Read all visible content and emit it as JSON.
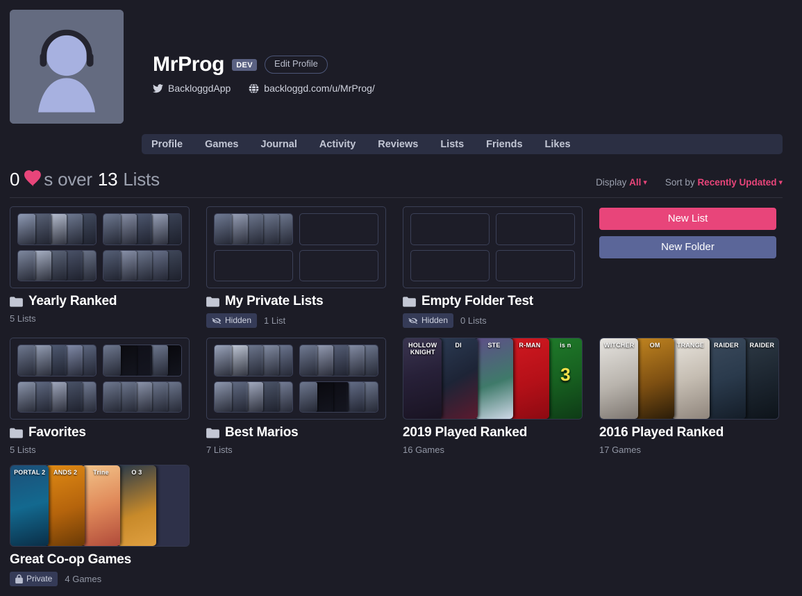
{
  "profile": {
    "username": "MrProg",
    "dev_badge": "DEV",
    "edit_button": "Edit Profile",
    "twitter_handle": "BackloggdApp",
    "website": "backloggd.com/u/MrProg/",
    "avatar_icon": "default-user-headphones-avatar"
  },
  "nav": {
    "tabs": [
      {
        "label": "Profile"
      },
      {
        "label": "Games"
      },
      {
        "label": "Journal"
      },
      {
        "label": "Activity"
      },
      {
        "label": "Reviews"
      },
      {
        "label": "Lists"
      },
      {
        "label": "Friends"
      },
      {
        "label": "Likes"
      }
    ]
  },
  "section": {
    "like_count": "0",
    "heart_icon": "heart-icon",
    "middle_text": "s over",
    "list_count": "13",
    "suffix": "Lists",
    "display_label": "Display",
    "display_value": "All",
    "sort_label": "Sort by",
    "sort_value": "Recently Updated"
  },
  "actions": {
    "new_list": "New List",
    "new_folder": "New Folder"
  },
  "colors": {
    "background": "#1c1c26",
    "accent_pink": "#e8457a",
    "accent_slate": "#5b6699",
    "nav_bar": "#2b2f43",
    "badge": "#353b57"
  },
  "cards": [
    {
      "type": "folder",
      "title": "Yearly Ranked",
      "icon": "folder-icon",
      "count": "5 Lists",
      "badge": null,
      "mini_lists": [
        {
          "filled": true,
          "covers": [
            "#8e9ab4",
            "#5a6378",
            "#b8c0d2",
            "#6f7a92",
            "#434c60"
          ]
        },
        {
          "filled": true,
          "covers": [
            "#6d7890",
            "#878fa6",
            "#4e5870",
            "#9aa3ba",
            "#3b4356"
          ]
        },
        {
          "filled": true,
          "covers": [
            "#7e889f",
            "#a9b2c6",
            "#5c6579",
            "#4a5268",
            "#6a7388"
          ]
        },
        {
          "filled": true,
          "covers": [
            "#555f76",
            "#8a93ab",
            "#7c melhor",
            "#68718a",
            "#3f4759"
          ]
        }
      ]
    },
    {
      "type": "folder",
      "title": "My Private Lists",
      "icon": "folder-icon",
      "count": "1 List",
      "badge": {
        "label": "Hidden",
        "icon": "eye-slash-icon"
      },
      "mini_lists": [
        {
          "filled": true,
          "covers": [
            "#6f7a93",
            "#98a1b8",
            "#59melhor",
            "#7f melhor",
            "#4d melhor"
          ]
        },
        {
          "filled": false,
          "covers": []
        },
        {
          "filled": false,
          "covers": []
        },
        {
          "filled": false,
          "covers": []
        }
      ]
    },
    {
      "type": "folder",
      "title": "Empty Folder Test",
      "icon": "folder-icon",
      "count": "0 Lists",
      "badge": {
        "label": "Hidden",
        "icon": "eye-slash-icon"
      },
      "mini_lists": [
        {
          "filled": false,
          "covers": []
        },
        {
          "filled": false,
          "covers": []
        },
        {
          "filled": false,
          "covers": []
        },
        {
          "filled": false,
          "covers": []
        }
      ]
    },
    {
      "type": "folder",
      "title": "Favorites",
      "icon": "folder-icon",
      "count": "5 Lists",
      "badge": null,
      "mini_lists": [
        {
          "filled": true,
          "covers": [
            "#74melhor",
            "#96a0b6",
            "#4f5a72",
            "#828caa",
            "#5d6780"
          ]
        },
        {
          "filled": true,
          "covers": [
            "#7b8losa",
            "#0b0b10",
            "#101019",
            "#6a melhor",
            "#08080d"
          ]
        },
        {
          "filled": true,
          "covers": [
            "#8b95ab",
            "#606a82",
            "#a3abc0",
            "#4a5368",
            "#737d95"
          ]
        },
        {
          "filled": true,
          "covers": [
            "#69melhor",
            "#3e melhor",
            "#8d96ad",
            "#5a melhor",
            "#7a melhor"
          ]
        }
      ]
    },
    {
      "type": "folder",
      "title": "Best Marios",
      "icon": "folder-icon",
      "count": "7 Lists",
      "badge": null,
      "mini_lists": [
        {
          "filled": true,
          "covers": [
            "#9aa4bb",
            "#c2cad9",
            "#5f melhor",
            "#848ea5",
            "#6c7690"
          ]
        },
        {
          "filled": true,
          "covers": [
            "#707a92",
            "#959db4",
            "#565f77",
            "#868fa7",
            "#4b melhor"
          ]
        },
        {
          "filled": true,
          "covers": [
            "#8d97ae",
            "#626c84",
            "#a5adc2",
            "#4c5569",
            "#767f97"
          ]
        },
        {
          "filled": true,
          "covers": [
            "#7f melhor",
            "#09090e",
            "#0d0d14",
            "#646e88",
            "#070 70c"
          ]
        }
      ]
    },
    {
      "type": "list",
      "title": "2019 Played Ranked",
      "count": "16 Games",
      "badge": null,
      "covers": [
        {
          "bg": "linear-gradient(165deg,#3a3550 0%,#272038 45%,#191322 100%)",
          "caption": "HOLLOW KNIGHT",
          "big": null
        },
        {
          "bg": "linear-gradient(150deg,#2b3a52 0%,#1d2436 50%,#5c1a2e 100%)",
          "caption": "DI",
          "big": null
        },
        {
          "bg": "linear-gradient(160deg,#5e4f88 0%,#3f7a6a 55%,#cfd8e8 100%)",
          "caption": "STE",
          "big": null
        },
        {
          "bg": "linear-gradient(160deg,#d01820 0%,#b41018 55%,#8d0a12 100%)",
          "caption": "R-MAN",
          "big": null
        },
        {
          "bg": "linear-gradient(160deg,#1f7a2a 0%,#176020 50%,#0e3a16 100%)",
          "caption": "is n",
          "big": "3"
        }
      ]
    },
    {
      "type": "list",
      "title": "2016 Played Ranked",
      "count": "17 Games",
      "badge": null,
      "covers": [
        {
          "bg": "linear-gradient(160deg,#e6e4e0 0%,#b9b4ad 55%,#7d7670 100%)",
          "caption": "WITCHER",
          "big": null
        },
        {
          "bg": "linear-gradient(160deg,#c08420 0%,#7d4f12 55%,#2a1c08 100%)",
          "caption": "OM",
          "big": null
        },
        {
          "bg": "linear-gradient(160deg,#e9e5de 0%,#c5bdb2 50%,#8f857c 100%)",
          "caption": "TRANGE",
          "big": null
        },
        {
          "bg": "linear-gradient(160deg,#3b4a5c 0%,#2a3a4c 50%,#141d28 100%)",
          "caption": "RAIDER",
          "big": null
        },
        {
          "bg": "linear-gradient(160deg,#2e3a46 0%,#1b242e 55%,#0d1319 100%)",
          "caption": "RAIDER",
          "big": null
        }
      ]
    },
    {
      "type": "list",
      "title": "Great Co-op Games",
      "count": "4 Games",
      "badge": {
        "label": "Private",
        "icon": "lock-icon"
      },
      "covers": [
        {
          "bg": "linear-gradient(165deg,#1c4f78 0%,#13698f 50%,#0a2e47 100%)",
          "caption": "PORTAL 2",
          "big": null
        },
        {
          "bg": "linear-gradient(160deg,#e08a14 0%,#b5640c 55%,#6a3a06 100%)",
          "caption": "ANDS 2",
          "big": null
        },
        {
          "bg": "linear-gradient(160deg,#f2c48a 0%,#e08a5a 50%,#b04a3a 100%)",
          "caption": "Trine",
          "big": null
        },
        {
          "bg": "linear-gradient(160deg,#2a3a4a 0%,#c88a2a 60%,#e0a040 100%)",
          "caption": "O 3",
          "big": null
        },
        {
          "blank": true,
          "caption": null,
          "big": null
        }
      ]
    }
  ]
}
